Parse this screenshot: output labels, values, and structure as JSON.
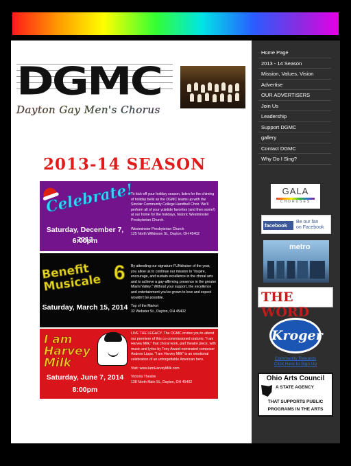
{
  "logo": {
    "letters": "DGMC",
    "subtitle": "Dayton Gay Men's Chorus"
  },
  "season_title": "2013-14 SEASON",
  "events": [
    {
      "headline": "Celebrate!",
      "date": "Saturday, December 7, 2013",
      "time": "6:00pm",
      "description": "To kick-off your holiday season, listen for the chiming of holiday bells as the DGMC teams up with the Sinclair Community College Handbell Choir. We'll perform all of your yuletide favorites (and then some!) at our home for the holidays, historic Westminster Presbyterian Church.",
      "venue": "Westminster Presbyterian Church",
      "address": "125 North Wilkinson St., Dayton, OH 45402"
    },
    {
      "headline": "Benefit Musicale",
      "number": "6",
      "date": "Saturday, March 15, 2014",
      "time": "",
      "description": "By attending our signature FUNdraiser of the year, you allow us to continue our mission to \"inspire, encourage, and sustain excellence in the choral arts and to achieve a gay-affirming presence in the greater Miami Valley.\" Without your support, the excellence and entertainment you've grown to love and expect wouldn't be possible.",
      "venue": "Top of the Market",
      "address": "32 Webster St., Dayton, OH 45402"
    },
    {
      "headline": "I am Harvey Milk",
      "date": "Saturday, June 7, 2014",
      "time": "8:00pm",
      "description": "LIVE THE LEGACY. The DGMC invites you to attend our premiere of this co-commissioned oratorio, \"I am Harvey Milk,\" that choral work, part theatre piece, with music and lyrics by Tony Award-nominated composer Andrew Lippa. \"I am Harvey Milk\" is an emotional celebration of an unforgettable American hero.",
      "visit": "Visit: www.IamHarveyMilk.com",
      "venue": "Victoria Theatre",
      "address": "138 North Main St., Dayton, OH 45402"
    }
  ],
  "nav": [
    "Home Page",
    "2013 - 14 Season",
    "Mission, Values, Vision",
    "Advertise",
    "OUR ADVERTISERS",
    "Join Us",
    "Leadership",
    "Support DGMC",
    "gallery",
    "Contact DGMC",
    "Why Do I Sing?"
  ],
  "sponsors": {
    "gala_name": "GALA",
    "gala_sub": "CHORUSES",
    "facebook_logo": "facebook",
    "facebook_text_1": "Be our fan",
    "facebook_text_2": "on Facebook",
    "metro_name": "metro",
    "word_name": "THE WORD",
    "kroger_name": "Kroger",
    "kroger_link_1": "Community Rewards",
    "kroger_link_2": "Click Here to Sign Up",
    "oac_title": "Ohio Arts Council",
    "oac_line1": "A STATE AGENCY",
    "oac_line2": "THAT SUPPORTS PUBLIC",
    "oac_line3": "PROGRAMS IN THE ARTS"
  },
  "colors": {
    "season_title": "#e01b1b",
    "sidebar_bg": "#2e2e2e",
    "event1_bg": "#73148c",
    "event2_bg": "#070707",
    "event3_bg": "#d9141b"
  }
}
